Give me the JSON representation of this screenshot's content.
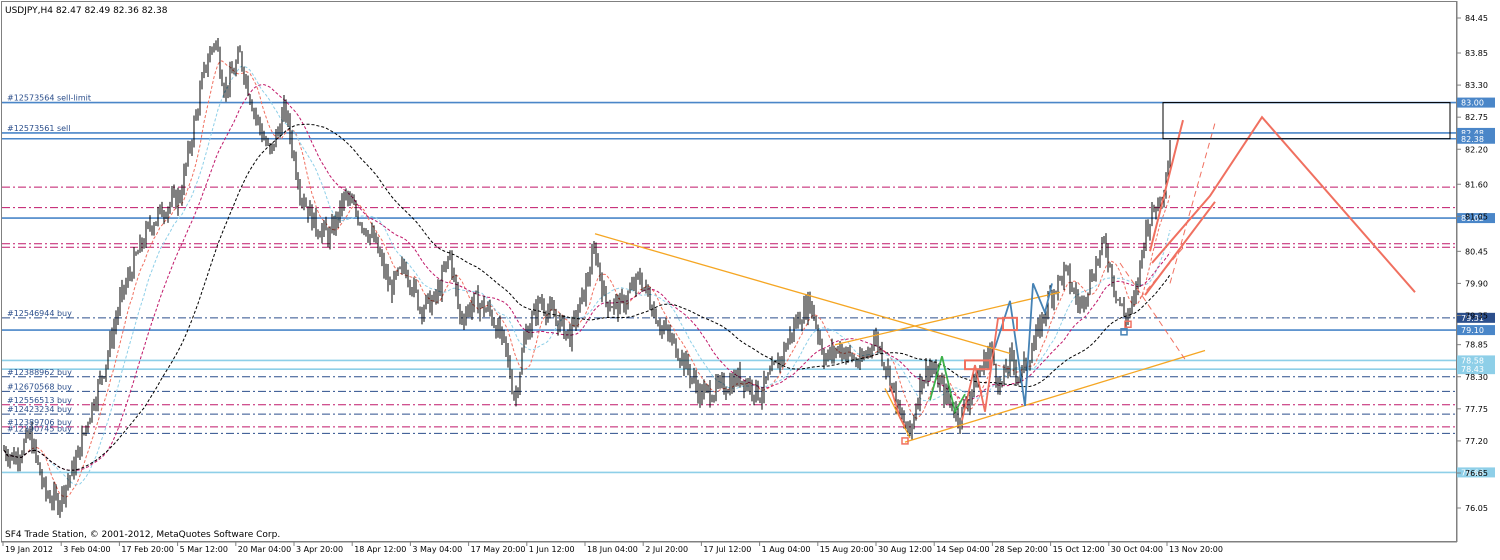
{
  "window": {
    "symbol_header": "USDJPY,H4  82.47 82.49 82.36 82.38",
    "copyright": "SF4 Trade Station, © 2001-2012, MetaQuotes Software Corp."
  },
  "colors": {
    "background": "#ffffff",
    "frame": "#808080",
    "candles": "#000000",
    "blue_level": "#4a86c8",
    "light_blue_level": "#8ecfe8",
    "magenta_level": "#c0186a",
    "navy_level": "#2c4f8c",
    "orange_trend": "#f5a623",
    "salmon_projection": "#f07060",
    "steelblue_zigzag": "#4682b4",
    "green_zigzag": "#3cb04a",
    "label_box": "#8ecfe8"
  },
  "chart_data": {
    "type": "candlestick",
    "instrument": "USDJPY",
    "timeframe": "H4",
    "ohlc_last": {
      "open": 82.47,
      "high": 82.49,
      "low": 82.36,
      "close": 82.38
    },
    "ylim": [
      75.95,
      84.55
    ],
    "y_ticks": [
      "84.45",
      "83.85",
      "83.30",
      "82.75",
      "82.20",
      "81.60",
      "81.05",
      "80.45",
      "79.90",
      "79.35",
      "78.85",
      "78.30",
      "77.75",
      "77.20",
      "76.65",
      "76.05"
    ],
    "x_ticks": [
      "19 Jan 2012",
      "3 Feb 04:00",
      "17 Feb 20:00",
      "5 Mar 12:00",
      "20 Mar 04:00",
      "3 Apr 20:00",
      "18 Apr 12:00",
      "3 May 04:00",
      "17 May 20:00",
      "1 Jun 12:00",
      "18 Jun 04:00",
      "2 Jul 20:00",
      "17 Jul 12:00",
      "1 Aug 04:00",
      "15 Aug 20:00",
      "30 Aug 12:00",
      "14 Sep 04:00",
      "28 Sep 20:00",
      "15 Oct 12:00",
      "30 Oct 04:00",
      "13 Nov 20:00"
    ],
    "price_path_keypoints": [
      [
        0,
        77.1
      ],
      [
        15,
        76.9
      ],
      [
        30,
        77.3
      ],
      [
        45,
        76.3
      ],
      [
        58,
        76.15
      ],
      [
        75,
        76.8
      ],
      [
        90,
        77.7
      ],
      [
        105,
        78.5
      ],
      [
        120,
        79.6
      ],
      [
        135,
        80.3
      ],
      [
        150,
        80.9
      ],
      [
        165,
        81.2
      ],
      [
        180,
        81.4
      ],
      [
        195,
        82.7
      ],
      [
        205,
        83.6
      ],
      [
        215,
        84.1
      ],
      [
        225,
        83.2
      ],
      [
        240,
        83.8
      ],
      [
        255,
        82.8
      ],
      [
        270,
        82.1
      ],
      [
        285,
        82.9
      ],
      [
        300,
        81.5
      ],
      [
        315,
        80.9
      ],
      [
        330,
        80.7
      ],
      [
        345,
        81.4
      ],
      [
        360,
        81.0
      ],
      [
        375,
        80.6
      ],
      [
        390,
        79.8
      ],
      [
        405,
        80.2
      ],
      [
        420,
        79.5
      ],
      [
        435,
        79.6
      ],
      [
        450,
        80.4
      ],
      [
        460,
        79.3
      ],
      [
        475,
        79.6
      ],
      [
        490,
        79.4
      ],
      [
        505,
        78.8
      ],
      [
        515,
        77.9
      ],
      [
        525,
        79.0
      ],
      [
        540,
        79.6
      ],
      [
        555,
        79.3
      ],
      [
        570,
        79.0
      ],
      [
        585,
        79.8
      ],
      [
        595,
        80.5
      ],
      [
        605,
        79.6
      ],
      [
        620,
        79.5
      ],
      [
        640,
        80.0
      ],
      [
        660,
        79.2
      ],
      [
        680,
        78.7
      ],
      [
        700,
        78.0
      ],
      [
        720,
        78.1
      ],
      [
        740,
        78.3
      ],
      [
        760,
        78.0
      ],
      [
        780,
        78.6
      ],
      [
        795,
        79.2
      ],
      [
        810,
        79.6
      ],
      [
        825,
        78.6
      ],
      [
        840,
        78.8
      ],
      [
        860,
        78.5
      ],
      [
        875,
        79.0
      ],
      [
        890,
        78.3
      ],
      [
        900,
        77.6
      ],
      [
        910,
        77.3
      ],
      [
        920,
        78.2
      ],
      [
        930,
        78.5
      ],
      [
        945,
        78.0
      ],
      [
        960,
        77.6
      ],
      [
        975,
        78.2
      ],
      [
        990,
        78.8
      ],
      [
        1000,
        78.1
      ],
      [
        1010,
        78.6
      ],
      [
        1020,
        78.3
      ],
      [
        1035,
        78.9
      ],
      [
        1050,
        79.7
      ],
      [
        1065,
        80.1
      ],
      [
        1080,
        79.5
      ],
      [
        1095,
        80.2
      ],
      [
        1105,
        80.6
      ],
      [
        1115,
        79.8
      ],
      [
        1125,
        79.3
      ],
      [
        1135,
        79.6
      ],
      [
        1145,
        80.8
      ],
      [
        1155,
        81.2
      ],
      [
        1165,
        81.6
      ],
      [
        1170,
        82.3
      ]
    ],
    "moving_averages": [
      {
        "color": "#f07060",
        "lag": 10
      },
      {
        "color": "#8ecfe8",
        "lag": 20
      },
      {
        "color": "#c0186a",
        "lag": 35
      },
      {
        "color": "#000000",
        "lag": 70
      }
    ],
    "horizontal_levels": [
      {
        "price": 83.0,
        "style": "solid",
        "color": "#4a86c8",
        "label": "#12573564 sell-limit",
        "tag": "83.00"
      },
      {
        "price": 82.48,
        "style": "solid",
        "color": "#4a86c8",
        "label": "#12573561 sell",
        "tag": "82.48"
      },
      {
        "price": 82.38,
        "style": "solid",
        "color": "#4a86c8",
        "label": "",
        "tag": "82.38"
      },
      {
        "price": 81.55,
        "style": "dashdot",
        "color": "#c0186a",
        "label": "",
        "tag": ""
      },
      {
        "price": 81.2,
        "style": "dashdot",
        "color": "#c0186a",
        "label": "",
        "tag": ""
      },
      {
        "price": 81.02,
        "style": "solid",
        "color": "#4a86c8",
        "label": "",
        "tag": "81.02"
      },
      {
        "price": 80.58,
        "style": "dashdot",
        "color": "#c0186a",
        "label": "",
        "tag": ""
      },
      {
        "price": 80.52,
        "style": "dashdot",
        "color": "#c0186a",
        "label": "",
        "tag": ""
      },
      {
        "price": 79.31,
        "style": "dashdot",
        "color": "#2c4f8c",
        "label": "#12546944 buy",
        "tag": "79.31"
      },
      {
        "price": 79.1,
        "style": "solid",
        "color": "#4a86c8",
        "label": "",
        "tag": "79.10"
      },
      {
        "price": 78.58,
        "style": "solid",
        "color": "#8ecfe8",
        "label": "",
        "tag": "78.58"
      },
      {
        "price": 78.43,
        "style": "solid",
        "color": "#8ecfe8",
        "label": "",
        "tag": "78.43"
      },
      {
        "price": 78.3,
        "style": "dashdot",
        "color": "#2c4f8c",
        "label": "#12388962 buy",
        "tag": ""
      },
      {
        "price": 78.05,
        "style": "dashdot",
        "color": "#2c4f8c",
        "label": "#12670568 buy",
        "tag": ""
      },
      {
        "price": 77.82,
        "style": "dashdot",
        "color": "#c0186a",
        "label": "#12556513 buy",
        "tag": ""
      },
      {
        "price": 77.66,
        "style": "dashdot",
        "color": "#2c4f8c",
        "label": "#12423234 buy",
        "tag": ""
      },
      {
        "price": 77.44,
        "style": "dashdot",
        "color": "#c0186a",
        "label": "#12389706 buy",
        "tag": ""
      },
      {
        "price": 77.33,
        "style": "dashdot",
        "color": "#2c4f8c",
        "label": "#12390745 buy",
        "tag": ""
      },
      {
        "price": 76.66,
        "style": "solid",
        "color": "#8ecfe8",
        "label": "",
        "tag": "76.66"
      }
    ],
    "trend_lines": [
      {
        "color": "#f5a623",
        "style": "solid",
        "points": [
          [
            595,
            80.75
          ],
          [
            1010,
            78.7
          ]
        ]
      },
      {
        "color": "#f5a623",
        "style": "solid",
        "points": [
          [
            835,
            78.85
          ],
          [
            1060,
            79.75
          ]
        ]
      },
      {
        "color": "#f5a623",
        "style": "solid",
        "points": [
          [
            905,
            77.18
          ],
          [
            1205,
            78.75
          ]
        ]
      },
      {
        "color": "#f5a623",
        "style": "solid",
        "points": [
          [
            885,
            78.1
          ],
          [
            910,
            77.25
          ]
        ]
      }
    ],
    "projection_lines": [
      {
        "color": "#f07060",
        "style": "solid",
        "points": [
          [
            1152,
            80.25
          ],
          [
            1210,
            81.4
          ],
          [
            1262,
            82.75
          ],
          [
            1415,
            79.75
          ]
        ]
      },
      {
        "color": "#f07060",
        "style": "solid",
        "points": [
          [
            1145,
            79.7
          ],
          [
            1215,
            81.3
          ]
        ]
      },
      {
        "color": "#f07060",
        "style": "solid",
        "points": [
          [
            1150,
            80.45
          ],
          [
            1183,
            82.7
          ]
        ]
      },
      {
        "color": "#f07060",
        "style": "dashed",
        "points": [
          [
            1170,
            79.9
          ],
          [
            1215,
            82.65
          ]
        ]
      },
      {
        "color": "#f07060",
        "style": "dashed",
        "points": [
          [
            1120,
            80.25
          ],
          [
            1185,
            78.6
          ]
        ]
      },
      {
        "color": "#f07060",
        "style": "dashed",
        "points": [
          [
            1140,
            79.65
          ],
          [
            1185,
            80.55
          ]
        ]
      }
    ],
    "zigzags": [
      {
        "color": "#4682b4",
        "points": [
          [
            995,
            78.8
          ],
          [
            1010,
            79.6
          ],
          [
            1025,
            77.8
          ],
          [
            1033,
            79.9
          ],
          [
            1045,
            79.4
          ],
          [
            1052,
            79.9
          ]
        ]
      },
      {
        "color": "#3cb04a",
        "points": [
          [
            930,
            77.9
          ],
          [
            942,
            78.65
          ],
          [
            955,
            77.7
          ],
          [
            965,
            78.0
          ]
        ]
      },
      {
        "color": "#f07060",
        "points": [
          [
            962,
            77.55
          ],
          [
            975,
            78.5
          ],
          [
            985,
            77.7
          ],
          [
            998,
            79.3
          ],
          [
            1005,
            79.3
          ]
        ]
      },
      {
        "color": "#f07060",
        "points": [
          [
            890,
            78.15
          ],
          [
            900,
            77.6
          ],
          [
            905,
            77.45
          ]
        ]
      }
    ],
    "rectangles": [
      {
        "color": "#000000",
        "x1": 1163,
        "x2": 1450,
        "y1": 83.0,
        "y2": 82.38
      },
      {
        "color": "#f07060",
        "x1": 1003,
        "x2": 1017,
        "y1": 79.31,
        "y2": 79.1
      },
      {
        "color": "#f07060",
        "x1": 965,
        "x2": 990,
        "y1": 78.58,
        "y2": 78.43
      }
    ],
    "markers": [
      {
        "color": "#4682b4",
        "x": 1124,
        "price": 79.07
      },
      {
        "color": "#f07060",
        "x": 905,
        "price": 77.2
      },
      {
        "color": "#f07060",
        "x": 1128,
        "price": 79.2
      }
    ]
  }
}
